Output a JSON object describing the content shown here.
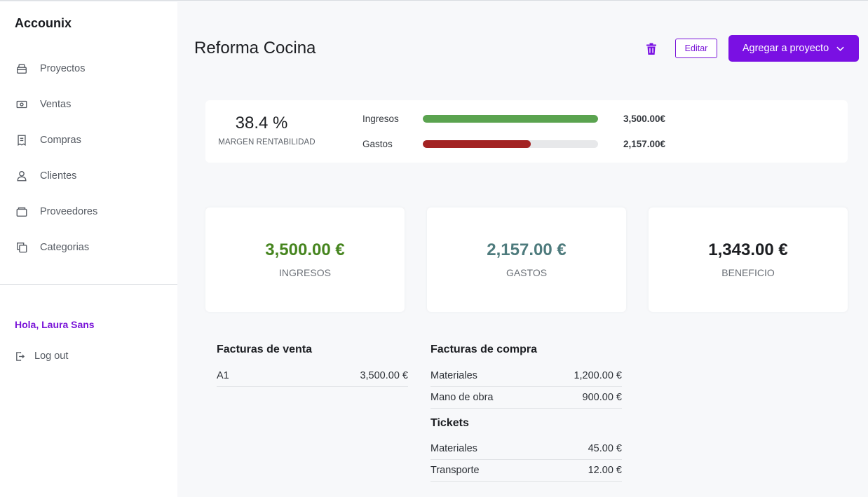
{
  "app": {
    "name": "Accounix"
  },
  "sidebar": {
    "items": [
      {
        "label": "Proyectos",
        "icon": "projects-icon"
      },
      {
        "label": "Ventas",
        "icon": "money-icon"
      },
      {
        "label": "Compras",
        "icon": "receipt-icon"
      },
      {
        "label": "Clientes",
        "icon": "user-icon"
      },
      {
        "label": "Proveedores",
        "icon": "briefcase-icon"
      },
      {
        "label": "Categorias",
        "icon": "copy-icon"
      }
    ],
    "greeting": "Hola, Laura Sans",
    "logout": "Log out"
  },
  "header": {
    "title": "Reforma Cocina",
    "edit_label": "Editar",
    "add_label": "Agregar a proyecto"
  },
  "summary": {
    "margin_value": "38.4 %",
    "margin_label": "MARGEN RENTABILIDAD",
    "income": {
      "label": "Ingresos",
      "amount": "3,500.00€",
      "fill_fraction": 1.0,
      "color": "#5aa34f"
    },
    "expenses": {
      "label": "Gastos",
      "amount": "2,157.00€",
      "fill_fraction": 0.616,
      "color": "#a32323"
    }
  },
  "cards": [
    {
      "value": "3,500.00 €",
      "label": "INGRESOS",
      "color": "#46851f"
    },
    {
      "value": "2,157.00 €",
      "label": "GASTOS",
      "color": "#4e7b7d"
    },
    {
      "value": "1,343.00 €",
      "label": "BENEFICIO",
      "color": "#1c1e22"
    }
  ],
  "sales_invoices": {
    "title": "Facturas de venta",
    "rows": [
      {
        "name": "A1",
        "amount": "3,500.00 €"
      }
    ]
  },
  "purchase_invoices": {
    "title": "Facturas de compra",
    "rows": [
      {
        "name": "Materiales",
        "amount": "1,200.00 €"
      },
      {
        "name": "Mano de obra",
        "amount": "900.00 €"
      }
    ]
  },
  "tickets": {
    "title": "Tickets",
    "rows": [
      {
        "name": "Materiales",
        "amount": "45.00 €"
      },
      {
        "name": "Transporte",
        "amount": "12.00 €"
      }
    ]
  },
  "colors": {
    "accent": "#7a10e3",
    "accent_text": "#7a15d8"
  }
}
